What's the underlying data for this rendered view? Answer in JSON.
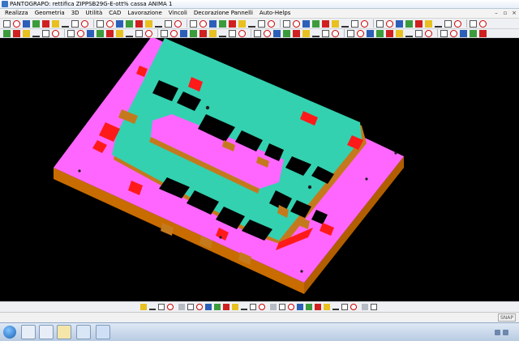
{
  "window": {
    "title": "PANTOGRAPO: rettifica ZIPPSB29G-E-ott% cassa ANIMA 1"
  },
  "menu": {
    "items": [
      "Realizza",
      "Geometria",
      "3D",
      "Utilità",
      "CAD",
      "Lavorazione",
      "Vincoli",
      "Decorazione Pannelli",
      "Auto-Helps"
    ]
  },
  "status": {
    "snap_label": "SNAP"
  },
  "icons": {
    "toolbar_rows": "cad-tool-icons",
    "bottom_row": "view-tool-icons",
    "taskbar": [
      "start-orb-icon",
      "explorer-icon",
      "media-icon",
      "app-icon",
      "cad-app-icon",
      "browser-icon"
    ]
  },
  "colors": {
    "base_top": "#ff66ff",
    "base_side": "#c66a00",
    "mould_surface": "#33d1b0",
    "mould_wall": "#c47a1c",
    "highlight": "#ff1a1a",
    "viewport_bg": "#000000"
  }
}
